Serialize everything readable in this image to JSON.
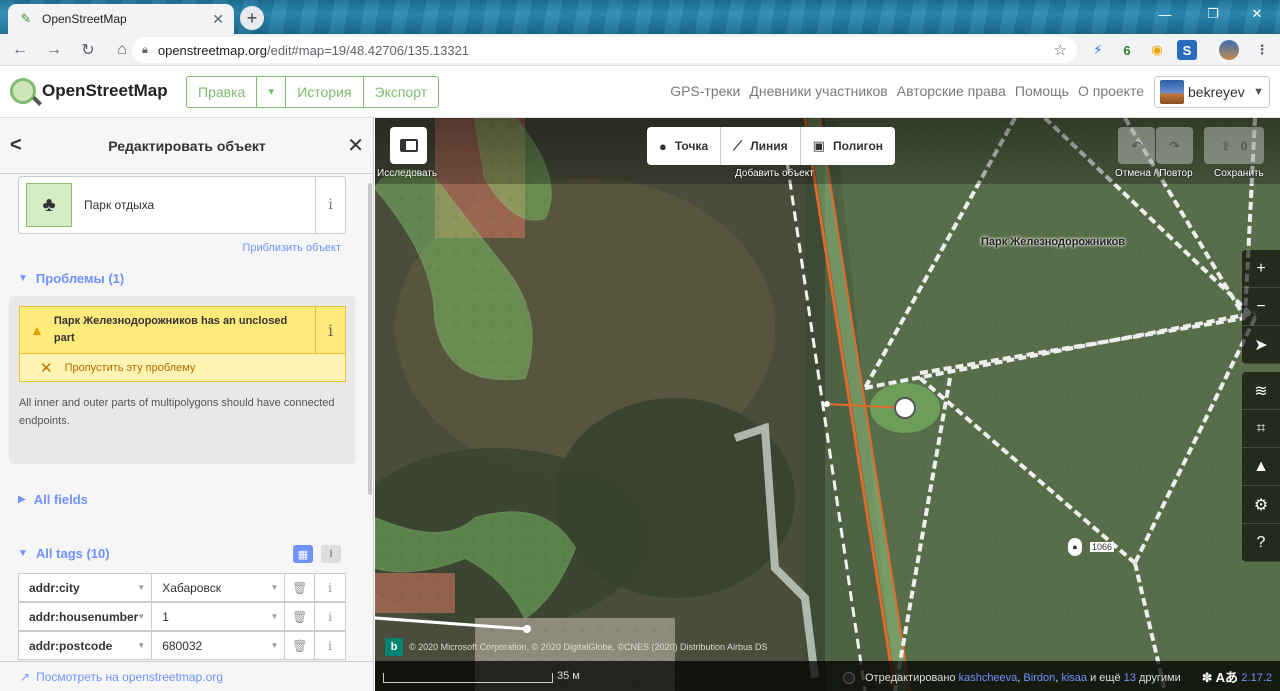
{
  "browser": {
    "tab_title": "OpenStreetMap",
    "url_host": "openstreetmap.org",
    "url_path": "/edit#map=19/48.42706/135.13321"
  },
  "osm_header": {
    "site_name": "OpenStreetMap",
    "edit_label": "Правка",
    "history_label": "История",
    "export_label": "Экспорт",
    "links": [
      "GPS-треки",
      "Дневники участников",
      "Авторские права",
      "Помощь",
      "О проекте"
    ],
    "username": "bekreyev"
  },
  "sidebar": {
    "title": "Редактировать объект",
    "preset_name": "Парк отдыха",
    "zoom_link": "Приблизить объект",
    "issues_title": "Проблемы (1)",
    "issue_text": "Парк Железнодорожников has an unclosed part",
    "ignore_label": "Пропустить эту проблему",
    "issue_description": "All inner and outer parts of multipolygons should have connected endpoints.",
    "all_fields_label": "All fields",
    "all_tags_label": "All tags (10)",
    "tags": [
      {
        "key": "addr:city",
        "value": "Хабаровск"
      },
      {
        "key": "addr:housenumber",
        "value": "1"
      },
      {
        "key": "addr:postcode",
        "value": "680032"
      }
    ],
    "footer_link": "Посмотреть на openstreetmap.org"
  },
  "map": {
    "explore_label": "Исследовать",
    "add_point": "Точка",
    "add_line": "Линия",
    "add_area": "Полигон",
    "add_object_label": "Добавить объект",
    "undo_redo_label": "Отмена / Повтор",
    "save_label": "Сохранить",
    "save_count": "0",
    "park_label": "Парк Железнодорожников",
    "poi_number": "1066",
    "attribution": "© 2020 Microsoft Corporation, © 2020 DigitalGlobe, ©CNES (2020) Distribution Airbus DS",
    "scale_label": "35 м",
    "edited_prefix": "Отредактировано",
    "editors": [
      "kashcheeva",
      "Birdon",
      "kisaa"
    ],
    "edited_and_more": "и ещё",
    "others_count": "13",
    "others_suffix": "другими",
    "language_glyph": "Aあ",
    "version": "2.17.2"
  }
}
